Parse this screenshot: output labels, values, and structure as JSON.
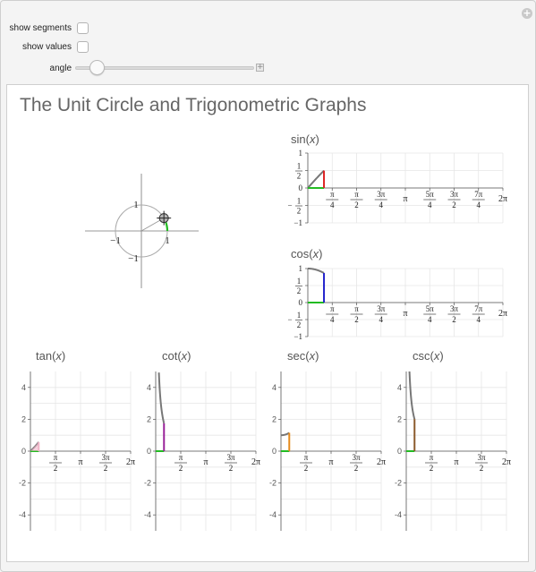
{
  "controls": {
    "show_segments_label": "show segments",
    "show_values_label": "show values",
    "angle_label": "angle",
    "angle_fraction": 0.12
  },
  "panel": {
    "title": "The Unit Circle and Trigonometric Graphs"
  },
  "unit_circle": {
    "ticks": {
      "pos_y": "1",
      "neg_x": "−1",
      "pos_x": "1",
      "neg_y": "−1"
    },
    "angle_radians": 0.52
  },
  "chart_data": [
    {
      "type": "line",
      "fn": "sin",
      "title_fn": "sin",
      "title_var": "x",
      "x_ticks": [
        "π/4",
        "π/2",
        "3π/4",
        "π",
        "5π/4",
        "3π/2",
        "7π/4",
        "2π"
      ],
      "y_ticks": [
        "1",
        "1/2",
        "0",
        "−1/2",
        "−1"
      ],
      "ylim": [
        -1,
        1
      ],
      "xlim": [
        0,
        6.2832
      ],
      "current_x": 0.52,
      "colors": {
        "curve": "#777777",
        "segment": "#dd2222",
        "base": "#22bb22"
      }
    },
    {
      "type": "line",
      "fn": "cos",
      "title_fn": "cos",
      "title_var": "x",
      "x_ticks": [
        "π/4",
        "π/2",
        "3π/4",
        "π",
        "5π/4",
        "3π/2",
        "7π/4",
        "2π"
      ],
      "y_ticks": [
        "1",
        "1/2",
        "0",
        "−1/2",
        "−1"
      ],
      "ylim": [
        -1,
        1
      ],
      "xlim": [
        0,
        6.2832
      ],
      "current_x": 0.52,
      "colors": {
        "curve": "#777777",
        "segment": "#2222cc",
        "base": "#22bb22"
      }
    },
    {
      "type": "line",
      "fn": "tan",
      "title_fn": "tan",
      "title_var": "x",
      "x_ticks": [
        "π/2",
        "π",
        "3π/2",
        "2π"
      ],
      "y_ticks": [
        "4",
        "2",
        "0",
        "-2",
        "-4"
      ],
      "ylim": [
        -5,
        5
      ],
      "xlim": [
        0,
        6.2832
      ],
      "current_x": 0.52,
      "colors": {
        "curve": "#777777",
        "segment": "#f0b4c8",
        "base": "#22bb22"
      }
    },
    {
      "type": "line",
      "fn": "cot",
      "title_fn": "cot",
      "title_var": "x",
      "x_ticks": [
        "π/2",
        "π",
        "3π/2",
        "2π"
      ],
      "y_ticks": [
        "4",
        "2",
        "0",
        "-2",
        "-4"
      ],
      "ylim": [
        -5,
        5
      ],
      "xlim": [
        0,
        6.2832
      ],
      "current_x": 0.52,
      "colors": {
        "curve": "#777777",
        "segment": "#992299",
        "base": "#22bb22"
      }
    },
    {
      "type": "line",
      "fn": "sec",
      "title_fn": "sec",
      "title_var": "x",
      "x_ticks": [
        "π/2",
        "π",
        "3π/2",
        "2π"
      ],
      "y_ticks": [
        "4",
        "2",
        "0",
        "-2",
        "-4"
      ],
      "ylim": [
        -5,
        5
      ],
      "xlim": [
        0,
        6.2832
      ],
      "current_x": 0.52,
      "colors": {
        "curve": "#777777",
        "segment": "#e58a1c",
        "base": "#22bb22"
      }
    },
    {
      "type": "line",
      "fn": "csc",
      "title_fn": "csc",
      "title_var": "x",
      "x_ticks": [
        "π/2",
        "π",
        "3π/2",
        "2π"
      ],
      "y_ticks": [
        "4",
        "2",
        "0",
        "-2",
        "-4"
      ],
      "ylim": [
        -5,
        5
      ],
      "xlim": [
        0,
        6.2832
      ],
      "current_x": 0.52,
      "colors": {
        "curve": "#777777",
        "segment": "#8b5a2b",
        "base": "#22bb22"
      }
    }
  ]
}
